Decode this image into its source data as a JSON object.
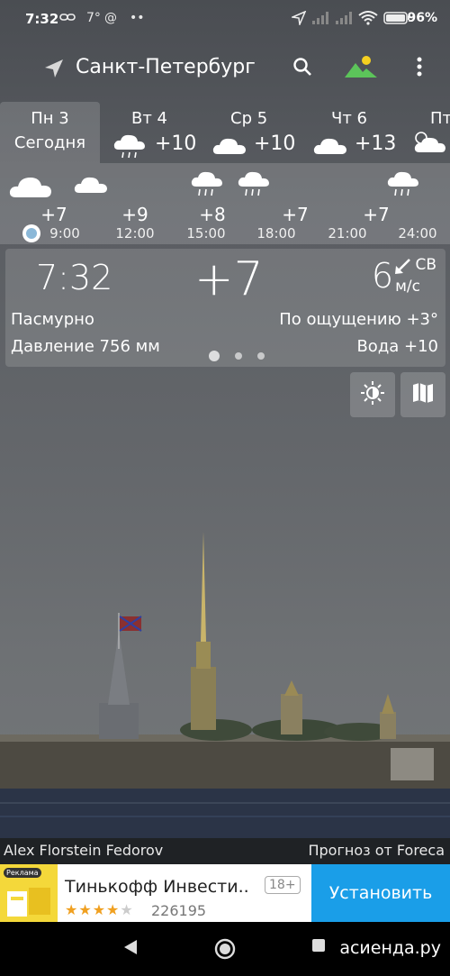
{
  "status_bar": {
    "time": "7:32",
    "temp": "7°",
    "battery": "96%"
  },
  "header": {
    "city": "Санкт-Петербург"
  },
  "days": [
    {
      "name": "Пн 3",
      "label": "Сегодня",
      "today": true
    },
    {
      "name": "Вт 4",
      "temp": "+10",
      "icon": "cloud-rain-icon"
    },
    {
      "name": "Ср 5",
      "temp": "+10",
      "icon": "cloud-icon"
    },
    {
      "name": "Чт 6",
      "temp": "+13",
      "icon": "cloud-icon"
    },
    {
      "name": "Пт",
      "icon": "partly-cloudy-icon"
    }
  ],
  "hourly": [
    {
      "time": "9:00",
      "temp": "+7"
    },
    {
      "time": "12:00",
      "temp": "+9"
    },
    {
      "time": "15:00",
      "temp": "+8"
    },
    {
      "time": "18:00",
      "temp": "+7"
    },
    {
      "time": "21:00",
      "temp": "+7"
    },
    {
      "time": "24:00",
      "temp": ""
    }
  ],
  "current": {
    "time": "7:32",
    "temp": "+7",
    "wind_speed": "6",
    "wind_dir": "СВ",
    "wind_unit": "м/с",
    "condition": "Пасмурно",
    "pressure": "Давление 756 мм",
    "feels_like": "По ощущению +3°",
    "water": "Вода +10"
  },
  "footer": {
    "author": "Alex Florstein Fedorov",
    "source": "Прогноз от Foreca"
  },
  "ad": {
    "tag": "Реклама",
    "title": "Тинькофф Инвести..",
    "age": "18+",
    "rating": 4,
    "reviews": "226195",
    "install": "Установить"
  },
  "watermark": "асиенда.ру",
  "colors": {
    "accent_install": "#1a9ee8",
    "ad_thumb": "#f4d83a",
    "icon_green": "#5cc45a",
    "icon_yellow": "#f5d020"
  }
}
